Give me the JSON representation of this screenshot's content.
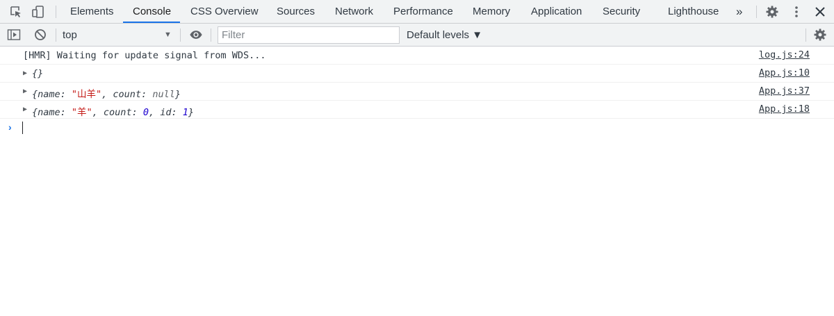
{
  "tabbar": {
    "tabs": [
      {
        "label": "Elements"
      },
      {
        "label": "Console"
      },
      {
        "label": "CSS Overview"
      },
      {
        "label": "Sources"
      },
      {
        "label": "Network"
      },
      {
        "label": "Performance"
      },
      {
        "label": "Memory"
      },
      {
        "label": "Application"
      },
      {
        "label": "Security"
      },
      {
        "label": "Lighthouse"
      }
    ],
    "active_tab": "Console",
    "more_tabs": "»",
    "close": "✕"
  },
  "toolbar": {
    "context": "top",
    "filter_placeholder": "Filter",
    "levels": "Default levels ▼"
  },
  "console": {
    "messages": [
      {
        "text": "[HMR] Waiting for update signal from WDS...",
        "source": "log.js:24"
      },
      {
        "text": "{}",
        "source": "App.js:10"
      },
      {
        "text": "{name: \"山羊\", count: null}",
        "source": "App.js:37",
        "parts": {
          "open": "{name: ",
          "str": "\"山羊\"",
          "mid": ", count: ",
          "val": "null",
          "close": "}"
        }
      },
      {
        "text": "{name: \"羊\", count: 0, id: 1}",
        "source": "App.js:18",
        "parts": {
          "open": "{name: ",
          "str": "\"羊\"",
          "mid": ", count: ",
          "val": "0",
          "mid2": ", id: ",
          "val2": "1",
          "close": "}"
        }
      }
    ],
    "prompt": "›"
  },
  "colors": {
    "accent": "#1a73e8",
    "string": "#c41a16",
    "number": "#1c00cf",
    "toolbar_bg": "#f1f3f4"
  }
}
